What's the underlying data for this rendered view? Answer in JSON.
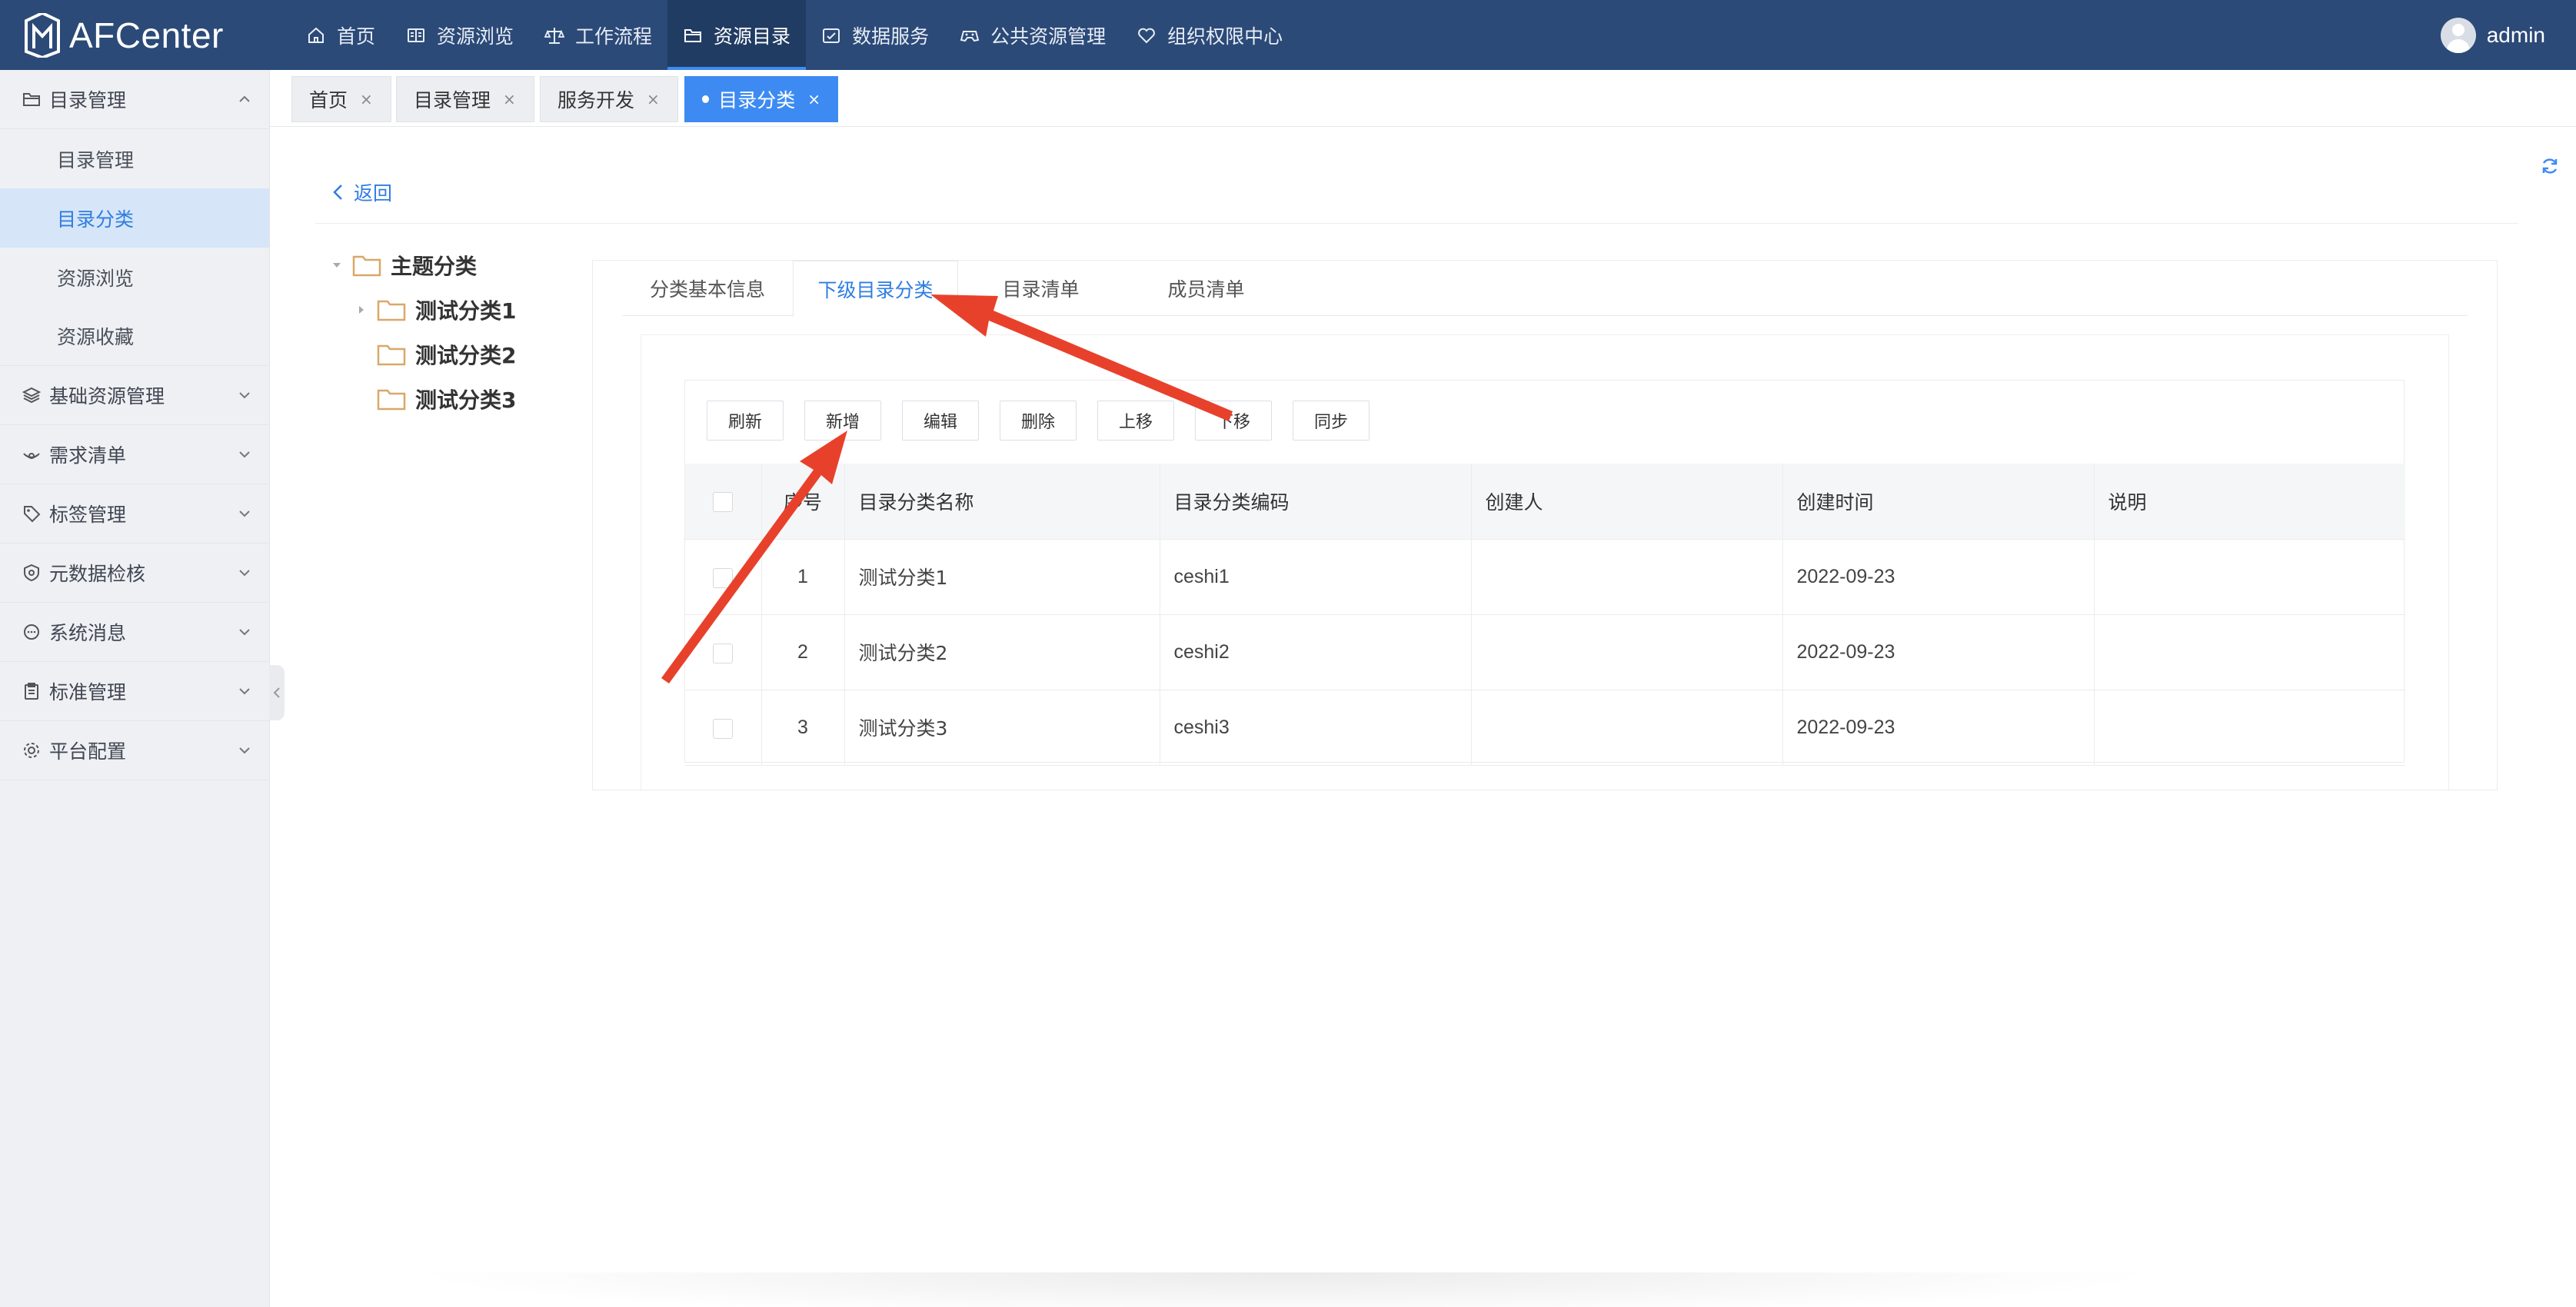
{
  "app": {
    "logo_text": "AFCenter",
    "user_name": "admin"
  },
  "topnav": {
    "items": [
      {
        "label": "首页",
        "icon": "home-icon"
      },
      {
        "label": "资源浏览",
        "icon": "browse-icon"
      },
      {
        "label": "工作流程",
        "icon": "scale-icon"
      },
      {
        "label": "资源目录",
        "icon": "folder-icon",
        "active": true
      },
      {
        "label": "数据服务",
        "icon": "service-icon"
      },
      {
        "label": "公共资源管理",
        "icon": "gamepad-icon"
      },
      {
        "label": "组织权限中心",
        "icon": "heart-icon"
      }
    ]
  },
  "sidebar": {
    "groups": [
      {
        "label": "目录管理",
        "icon": "folder-icon",
        "expanded": true,
        "children": [
          "目录管理",
          "目录分类",
          "资源浏览",
          "资源收藏"
        ],
        "active_child": "目录分类"
      },
      {
        "label": "基础资源管理",
        "icon": "layers-icon"
      },
      {
        "label": "需求清单",
        "icon": "signal-icon"
      },
      {
        "label": "标签管理",
        "icon": "tag-icon"
      },
      {
        "label": "元数据检核",
        "icon": "shield-icon"
      },
      {
        "label": "系统消息",
        "icon": "chat-icon"
      },
      {
        "label": "标准管理",
        "icon": "clipboard-icon"
      },
      {
        "label": "平台配置",
        "icon": "gear-icon"
      }
    ]
  },
  "page_tabs": [
    {
      "label": "首页"
    },
    {
      "label": "目录管理"
    },
    {
      "label": "服务开发"
    },
    {
      "label": "目录分类",
      "active": true
    }
  ],
  "back_label": "返回",
  "tree": {
    "root": "主题分类",
    "children": [
      "测试分类1",
      "测试分类2",
      "测试分类3"
    ]
  },
  "inner_tabs": [
    {
      "label": "分类基本信息"
    },
    {
      "label": "下级目录分类",
      "active": true
    },
    {
      "label": "目录清单"
    },
    {
      "label": "成员清单"
    }
  ],
  "toolbar": {
    "buttons": [
      "刷新",
      "新增",
      "编辑",
      "删除",
      "上移",
      "下移",
      "同步"
    ]
  },
  "table": {
    "columns": [
      "序号",
      "目录分类名称",
      "目录分类编码",
      "创建人",
      "创建时间",
      "说明"
    ],
    "rows": [
      {
        "index": "1",
        "name": "测试分类1",
        "code": "ceshi1",
        "creator": "",
        "created": "2022-09-23",
        "note": ""
      },
      {
        "index": "2",
        "name": "测试分类2",
        "code": "ceshi2",
        "creator": "",
        "created": "2022-09-23",
        "note": ""
      },
      {
        "index": "3",
        "name": "测试分类3",
        "code": "ceshi3",
        "creator": "",
        "created": "2022-09-23",
        "note": ""
      }
    ]
  },
  "colors": {
    "topbar": "#2b4a78",
    "accent": "#3d8bf2",
    "annotation": "#e8412b",
    "sidebar": "#eef0f3"
  }
}
